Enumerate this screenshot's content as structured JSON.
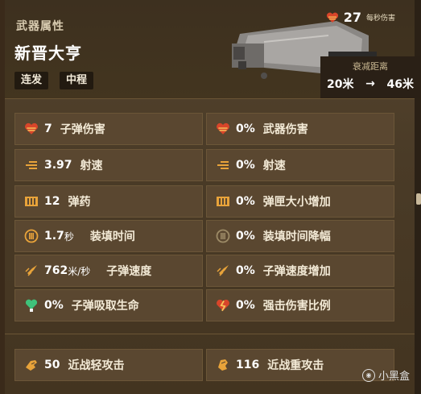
{
  "header": {
    "subtitle": "武器属性",
    "weapon_name": "新晋大亨",
    "tags": [
      "连发",
      "中程"
    ],
    "dps_value": "27",
    "dps_unit": "每秒伤害",
    "falloff_label": "衰减距离",
    "falloff_from": "20米",
    "falloff_to": "46米",
    "falloff_arrow": "→"
  },
  "stats_left": [
    {
      "icon": "bullet-damage-icon",
      "value": "7",
      "unit": "",
      "label": "子弹伤害"
    },
    {
      "icon": "fire-rate-icon",
      "value": "3.97",
      "unit": "",
      "label": "射速"
    },
    {
      "icon": "ammo-icon",
      "value": "12",
      "unit": "",
      "label": "弹药"
    },
    {
      "icon": "reload-icon",
      "value": "1.7",
      "unit": "秒",
      "label": "装填时间"
    },
    {
      "icon": "bullet-velocity-icon",
      "value": "762",
      "unit": "米/秒",
      "label": "子弹速度"
    },
    {
      "icon": "bullet-lifesteal-icon",
      "value": "0%",
      "unit": "",
      "label": "子弹吸取生命"
    }
  ],
  "stats_right": [
    {
      "icon": "weapon-damage-icon",
      "value": "0%",
      "label": "武器伤害"
    },
    {
      "icon": "fire-rate-icon",
      "value": "0%",
      "label": "射速"
    },
    {
      "icon": "ammo-icon",
      "value": "0%",
      "label": "弹匣大小增加"
    },
    {
      "icon": "reload-icon",
      "value": "0%",
      "label": "装填时间降幅"
    },
    {
      "icon": "bullet-velocity-icon",
      "value": "0%",
      "label": "子弹速度增加"
    },
    {
      "icon": "crit-damage-icon",
      "value": "0%",
      "label": "强击伤害比例"
    }
  ],
  "melee": [
    {
      "icon": "light-melee-icon",
      "value": "50",
      "label": "近战轻攻击"
    },
    {
      "icon": "heavy-melee-icon",
      "value": "116",
      "label": "近战重攻击"
    }
  ],
  "watermark": "小黑盒",
  "colors": {
    "accent_orange": "#e8a33a",
    "heart_red": "#d8452a",
    "lifesteal_green": "#3fc27a",
    "panel": "#5a4730"
  }
}
